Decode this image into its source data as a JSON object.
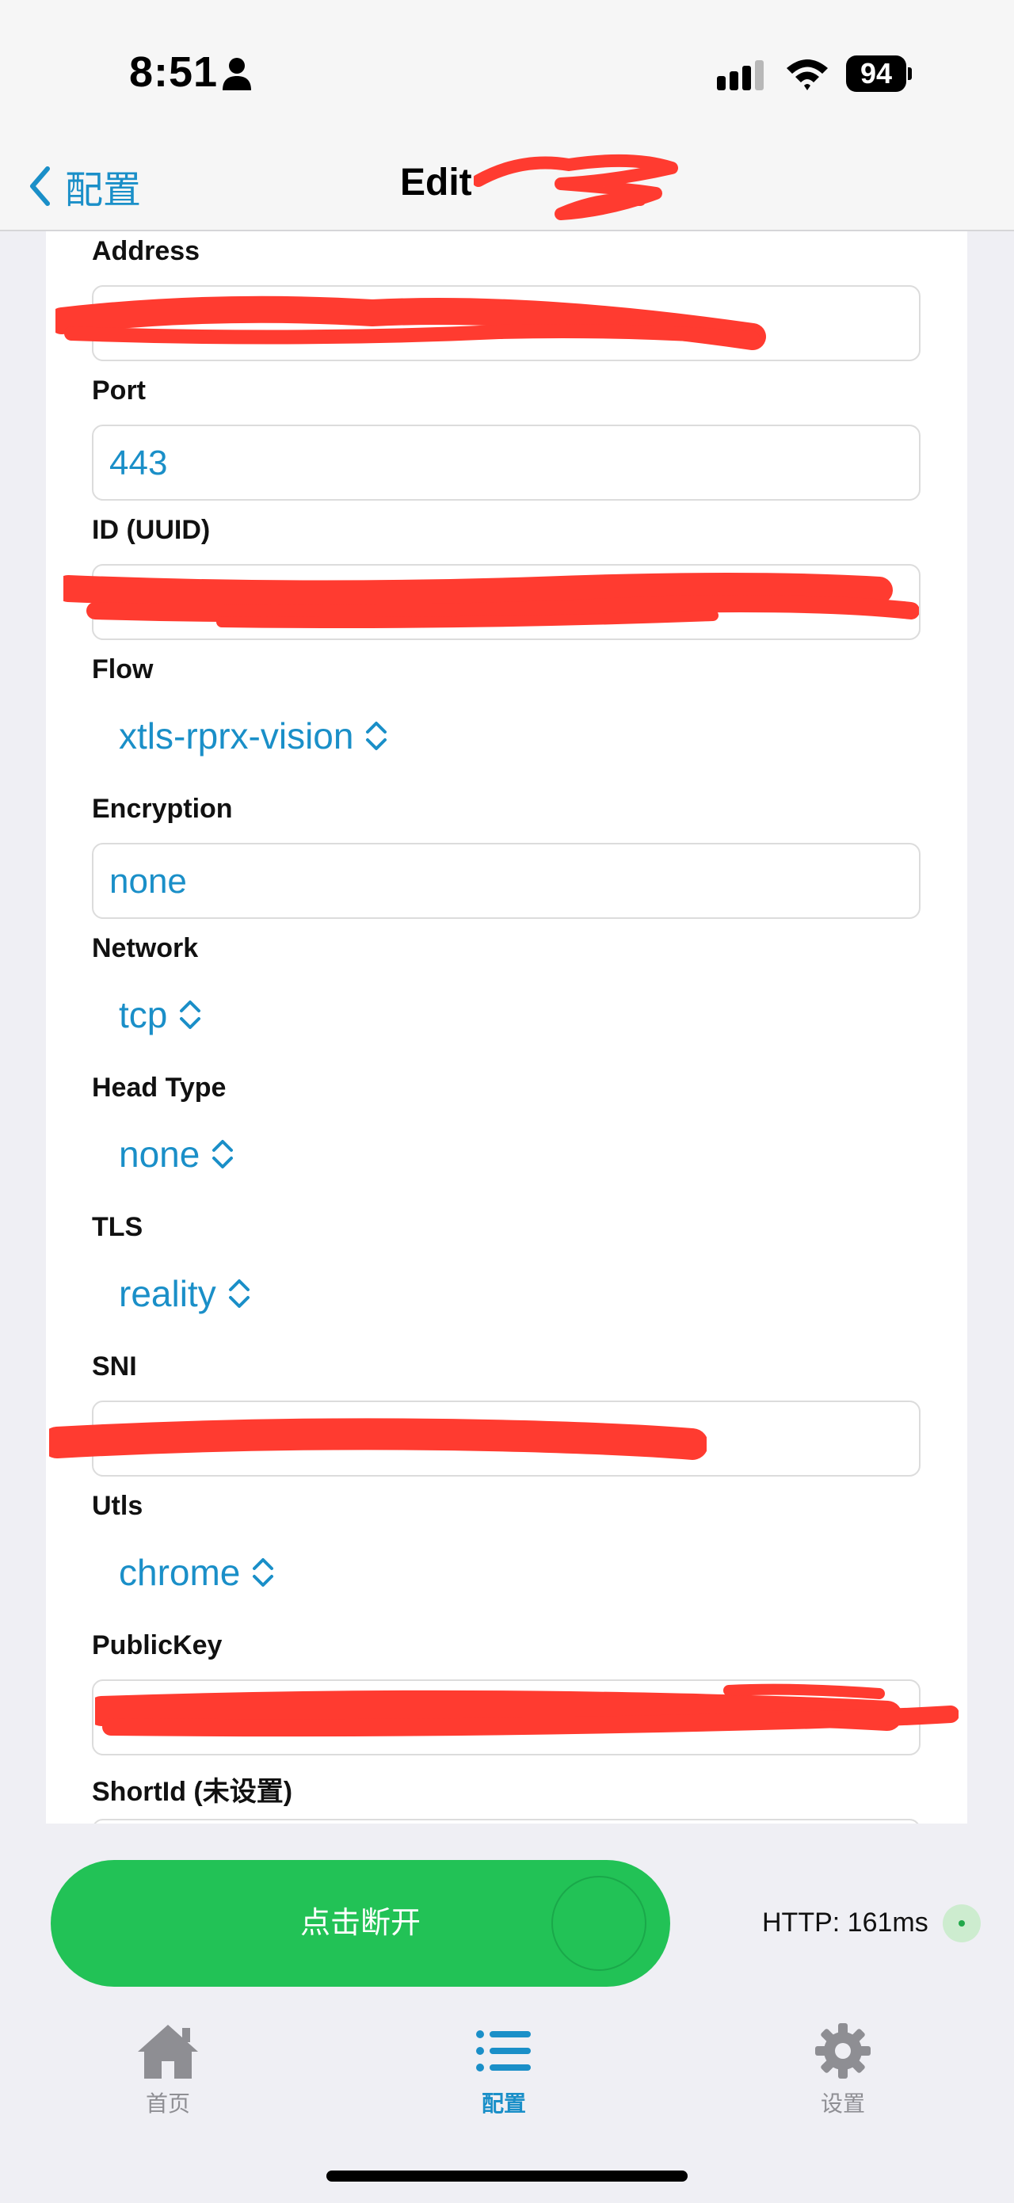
{
  "status_bar": {
    "time": "8:51",
    "battery": "94"
  },
  "nav": {
    "back_label": "配置",
    "title": "Edit"
  },
  "form": {
    "address": {
      "label": "Address",
      "value": ""
    },
    "port": {
      "label": "Port",
      "value": "443"
    },
    "id": {
      "label": "ID (UUID)",
      "value": ""
    },
    "flow": {
      "label": "Flow",
      "value": "xtls-rprx-vision"
    },
    "encryption": {
      "label": "Encryption",
      "value": "none"
    },
    "network": {
      "label": "Network",
      "value": "tcp"
    },
    "head_type": {
      "label": "Head Type",
      "value": "none"
    },
    "tls": {
      "label": "TLS",
      "value": "reality"
    },
    "sni": {
      "label": "SNI",
      "value": ""
    },
    "utls": {
      "label": "Utls",
      "value": "chrome"
    },
    "public_key": {
      "label": "PublicKey",
      "value": ""
    },
    "short_id": {
      "label": "ShortId (未设置)"
    }
  },
  "connect": {
    "button_label": "点击断开",
    "latency": "HTTP: 161ms"
  },
  "tabs": [
    {
      "label": "首页",
      "icon": "house-icon",
      "active": false
    },
    {
      "label": "配置",
      "icon": "list-icon",
      "active": true
    },
    {
      "label": "设置",
      "icon": "gear-icon",
      "active": false
    }
  ],
  "colors": {
    "accent": "#1a8fc8",
    "connect_green": "#22c256",
    "redaction": "#ff3b30",
    "tab_inactive": "#8e8e93"
  }
}
